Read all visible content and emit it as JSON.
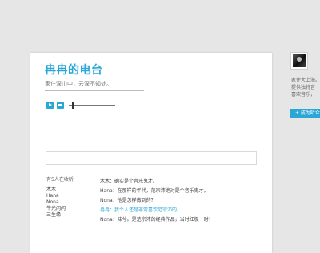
{
  "radio": {
    "title": "冉冉的电台",
    "subtitle": "家住深山中，云深不知处。"
  },
  "player": {
    "play_icon": "play-icon",
    "message_icon": "message-icon",
    "volume_level": 0.08
  },
  "comment": {
    "placeholder": ""
  },
  "listeners": {
    "heading": "有5人在收听",
    "names": [
      "木木",
      "Hana",
      "Nona",
      "牛光闪闪",
      "三生缘"
    ]
  },
  "chat": {
    "messages": [
      {
        "text": "木木：确实是个音乐鬼才。",
        "highlight": false
      },
      {
        "text": "Hana：在那样的年代，范宗沛绝对是个音乐鬼才。",
        "highlight": false
      },
      {
        "text": "Nona：他是怎样做到的？",
        "highlight": false
      },
      {
        "text": "冉冉：我个人还是非常喜欢范宗沛的。",
        "highlight": true
      },
      {
        "text": "Nona：味兮。是范宗沛的经典作品，当时红极一时！",
        "highlight": false
      }
    ],
    "accent_color": "#2aa7d6"
  },
  "profile": {
    "lines": [
      "家住大上海。",
      "提供独特音",
      "喜欢音乐，"
    ],
    "button_label": "+ 成为听众"
  }
}
